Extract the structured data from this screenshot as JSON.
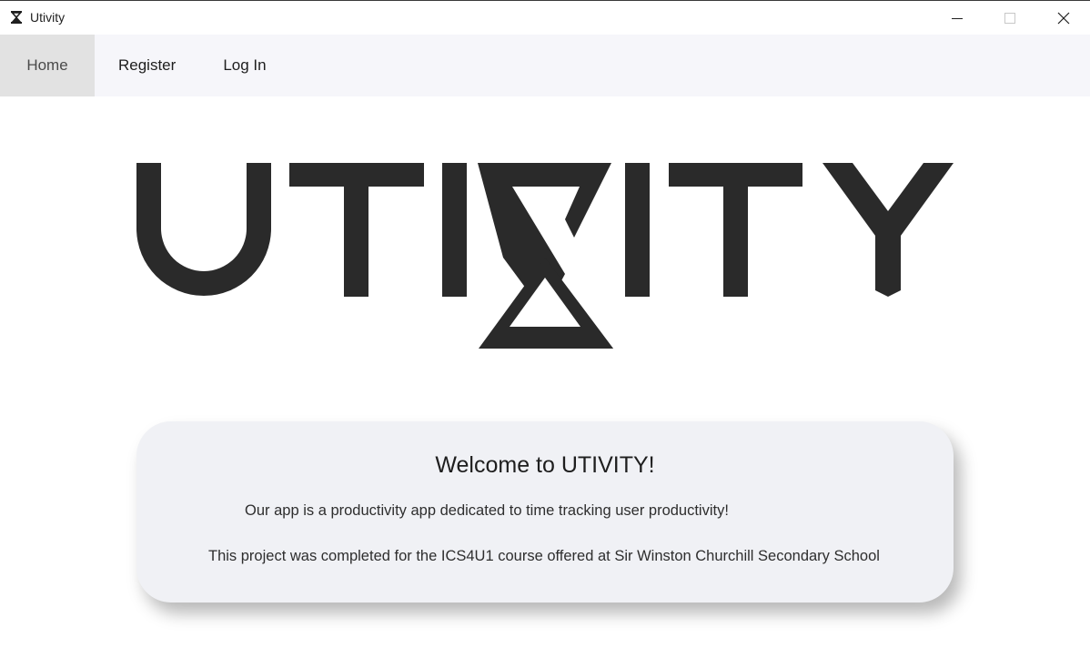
{
  "window": {
    "title": "Utivity",
    "app_icon": "hourglass-icon",
    "controls": {
      "minimize_icon": "minimize-icon",
      "maximize_icon": "maximize-icon",
      "close_icon": "close-icon"
    }
  },
  "nav": {
    "items": [
      {
        "label": "Home",
        "active": true
      },
      {
        "label": "Register",
        "active": false
      },
      {
        "label": "Log In",
        "active": false
      }
    ]
  },
  "logo": {
    "text": "UTIVITY",
    "color": "#2a2a2a"
  },
  "welcome": {
    "title": "Welcome to UTIVITY!",
    "line1": "Our app is a productivity app dedicated to time tracking user productivity!",
    "line2": "This project was completed for the ICS4U1 course offered at Sir Winston Churchill Secondary School"
  },
  "colors": {
    "nav_background": "#f6f6fa",
    "nav_active": "#e2e2e2",
    "card_background": "#f0f1f5",
    "logo": "#2a2a2a"
  }
}
